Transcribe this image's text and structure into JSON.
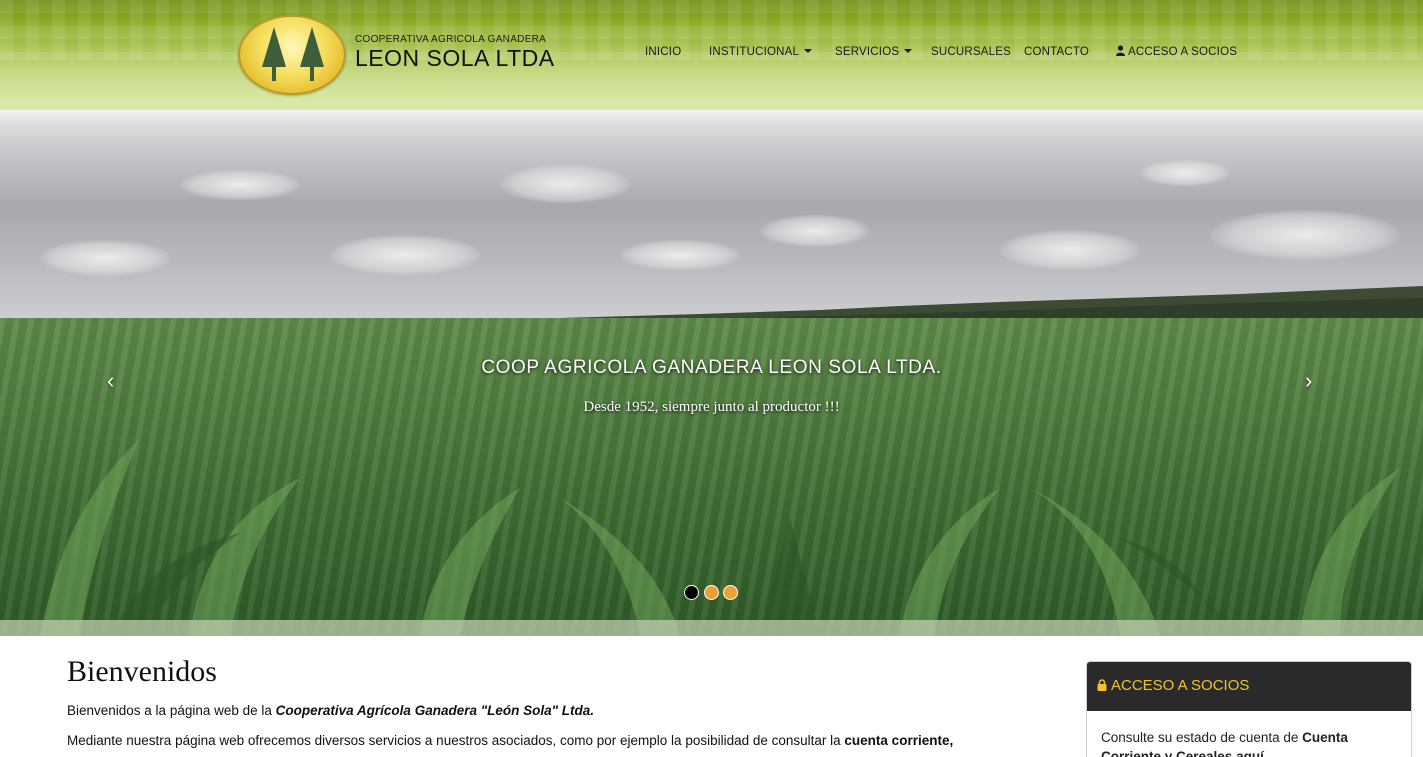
{
  "header": {
    "brand_subtitle": "COOPERATIVA AGRICOLA GANADERA",
    "brand_title": "LEON SOLA LTDA",
    "logo_icon": "twin-pine-trees-logo"
  },
  "nav": {
    "items": [
      {
        "label": "INICIO",
        "has_dropdown": false
      },
      {
        "label": "INSTITUCIONAL",
        "has_dropdown": true
      },
      {
        "label": "SERVICIOS",
        "has_dropdown": true
      },
      {
        "label": "SUCURSALES",
        "has_dropdown": false
      },
      {
        "label": "CONTACTO",
        "has_dropdown": false
      },
      {
        "label": "ACCESO A SOCIOS",
        "has_dropdown": false,
        "icon": "user-icon"
      }
    ]
  },
  "carousel": {
    "caption_title": "COOP AGRICOLA GANADERA LEON SOLA LTDA.",
    "caption_subtitle": "Desde 1952, siempre junto al productor !!!",
    "prev_label": "‹",
    "next_label": "›",
    "slide_count": 3,
    "active_slide": 1
  },
  "main": {
    "title": "Bienvenidos",
    "intro_prefix": "Bienvenidos a la página web de la ",
    "intro_emphasis": "Cooperativa  Agrícola Ganadera  \"León Sola\" Ltda.",
    "services_text": "Mediante nuestra página web ofrecemos diversos servicios a nuestros asociados, como  por ejemplo la posibilidad  de consultar la ",
    "services_bold": "cuenta corriente,"
  },
  "sidebar": {
    "panel_title": "ACCESO A SOCIOS",
    "panel_icon": "lock-icon",
    "body_prefix": "Consulte su estado de cuenta de ",
    "body_bold": "Cuenta Corriente y Cereales aquí"
  },
  "colors": {
    "header_green": "#8fae2a",
    "panel_head_bg": "#2a2a2a",
    "panel_head_text": "#f0c232",
    "indicator_inactive": "#eaa13a",
    "indicator_active": "#000000"
  }
}
